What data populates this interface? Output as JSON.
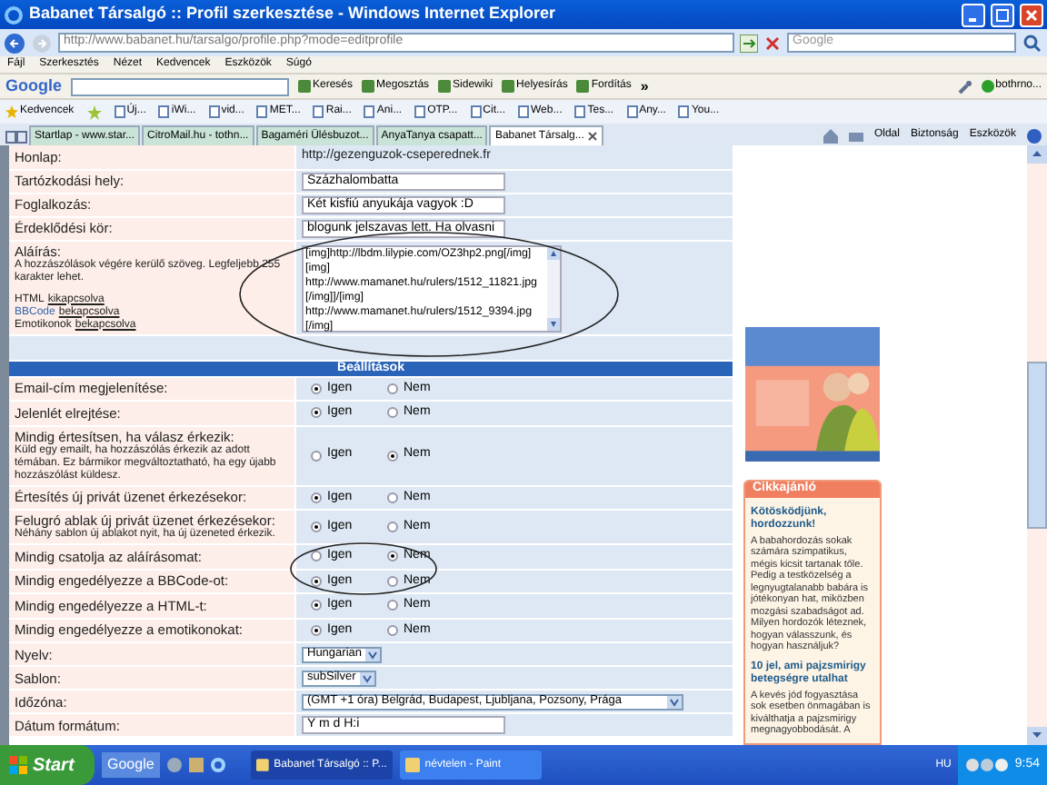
{
  "window": {
    "title": "Babanet Társalgó :: Profil szerkesztése - Windows Internet Explorer"
  },
  "address_bar": {
    "url": "http://www.babanet.hu/tarsalgo/profile.php?mode=editprofile",
    "search_placeholder": "Google"
  },
  "menu_bar": [
    "Fájl",
    "Szerkesztés",
    "Nézet",
    "Kedvencek",
    "Eszközök",
    "Súgó"
  ],
  "google_toolbar": {
    "logo": "Google",
    "buttons": [
      "Keresés",
      "Megosztás",
      "Sidewiki",
      "Helyesírás",
      "Fordítás"
    ],
    "more": "»",
    "account": "bothrno..."
  },
  "favorites_bar": {
    "label": "Kedvencek",
    "items": [
      "Új...",
      "iWi...",
      "vid...",
      "MET...",
      "Rai...",
      "Ani...",
      "OTP...",
      "Cit...",
      "Web...",
      "Tes...",
      "Any...",
      "You..."
    ]
  },
  "tabs": [
    {
      "label": "Startlap - www.star...",
      "selected": false
    },
    {
      "label": "CitroMail.hu - tothn...",
      "selected": false
    },
    {
      "label": "Bagaméri Ülésbuzot...",
      "selected": false
    },
    {
      "label": "AnyaTanya csapatt...",
      "selected": false
    },
    {
      "label": "Babanet Társalg...",
      "selected": true
    }
  ],
  "command_bar": [
    "Oldal",
    "Biztonság",
    "Eszközök"
  ],
  "profile_form": {
    "rows": [
      {
        "kind": "text",
        "label": "Honlap:",
        "value": "http://gezenguzok-cseperednek.fr"
      },
      {
        "kind": "input",
        "label": "Tartózkodási hely:",
        "value": "Százhalombatta"
      },
      {
        "kind": "input",
        "label": "Foglalkozás:",
        "value": "Két kisfiú anyukája vagyok :D"
      },
      {
        "kind": "input",
        "label": "Érdeklődési kör:",
        "value": "blogunk jelszavas lett. Ha olvasni"
      },
      {
        "kind": "signature",
        "label": "Aláírás:",
        "description": "A hozzászólások végére kerülő szöveg. Legfeljebb 255 karakter lehet.",
        "statuses": [
          {
            "name": "HTML",
            "value": "kikapcsolva"
          },
          {
            "name": "BBCode",
            "value": "bekapcsolva"
          },
          {
            "name": "Emotikonok",
            "value": "bekapcsolva"
          }
        ],
        "lines": [
          "[img]http://lbdm.lilypie.com/OZ3hp2.png[/img]",
          "[img]",
          "http://www.mamanet.hu/rulers/1512_11821.jpg",
          "[/img]]/[img]",
          "http://www.mamanet.hu/rulers/1512_9394.jpg",
          "[/img]"
        ]
      },
      {
        "kind": "spacer"
      },
      {
        "kind": "header",
        "label": "Beállítások"
      },
      {
        "kind": "choice",
        "label": "Email-cím megjelenítése:",
        "options": [
          {
            "label": "Igen",
            "selected": true
          },
          {
            "label": "Nem",
            "selected": false
          }
        ]
      },
      {
        "kind": "choice",
        "label": "Jelenlét elrejtése:",
        "options": [
          {
            "label": "Igen",
            "selected": true
          },
          {
            "label": "Nem",
            "selected": false
          }
        ]
      },
      {
        "kind": "choice",
        "label": "Mindig értesítsen, ha válasz érkezik:",
        "description": "Küld egy emailt, ha hozzászólás érkezik az adott témában. Ez bármikor megváltoztatható, ha egy újabb hozzászólást küldesz.",
        "options": [
          {
            "label": "Igen",
            "selected": false
          },
          {
            "label": "Nem",
            "selected": true
          }
        ]
      },
      {
        "kind": "choice",
        "label": "Értesítés új privát üzenet érkezésekor:",
        "options": [
          {
            "label": "Igen",
            "selected": true
          },
          {
            "label": "Nem",
            "selected": false
          }
        ]
      },
      {
        "kind": "choice",
        "label": "Felugró ablak új privát üzenet érkezésekor:",
        "description": "Néhány sablon új ablakot nyit, ha új üzeneted érkezik.",
        "options": [
          {
            "label": "Igen",
            "selected": true
          },
          {
            "label": "Nem",
            "selected": false
          }
        ]
      },
      {
        "kind": "choice",
        "label": "Mindig csatolja az aláírásomat:",
        "options": [
          {
            "label": "Igen",
            "selected": false
          },
          {
            "label": "Nem",
            "selected": true
          }
        ]
      },
      {
        "kind": "choice",
        "label": "Mindig engedélyezze a BBCode-ot:",
        "options": [
          {
            "label": "Igen",
            "selected": true
          },
          {
            "label": "Nem",
            "selected": false
          }
        ]
      },
      {
        "kind": "choice",
        "label": "Mindig engedélyezze a HTML-t:",
        "options": [
          {
            "label": "Igen",
            "selected": true
          },
          {
            "label": "Nem",
            "selected": false
          }
        ]
      },
      {
        "kind": "choice",
        "label": "Mindig engedélyezze a emotikonokat:",
        "options": [
          {
            "label": "Igen",
            "selected": true
          },
          {
            "label": "Nem",
            "selected": false
          }
        ]
      },
      {
        "kind": "select",
        "label": "Nyelv:",
        "value": "Hungarian"
      },
      {
        "kind": "select",
        "label": "Sablon:",
        "value": "subSilver"
      },
      {
        "kind": "select",
        "label": "Időzóna:",
        "value": "(GMT +1 óra) Belgrád, Budapest, Ljubljana, Pozsony, Prága",
        "wide": true
      },
      {
        "kind": "input",
        "label": "Dátum formátum:",
        "value": "Y m d H:i"
      }
    ]
  },
  "sidebar": {
    "box_title": "Cikkajánló",
    "articles": [
      {
        "title": "Kötösködjünk, hordozzunk!",
        "summary": "A babahordozás sokak számára szimpatikus, mégis kicsit tartanak tőle. Pedig a testközelség a legnyugtalanabb babára is jótékonyan hat, miközben mozgási szabadságot ad. Milyen hordozók léteznek, hogyan válasszunk, és hogyan használjuk?"
      },
      {
        "title": "10 jel, ami pajzsmirigy betegségre utalhat",
        "summary": "A kevés jód fogyasztása sok esetben önmagában is kiválthatja a pajzsmirigy megnagyobbodását. A"
      }
    ]
  },
  "taskbar": {
    "start": "Start",
    "search": "Google",
    "windows": [
      {
        "label": "Babanet Társalgó :: P...",
        "selected": true
      },
      {
        "label": "névtelen - Paint",
        "selected": false
      }
    ],
    "language": "HU",
    "clock": "9:54"
  }
}
